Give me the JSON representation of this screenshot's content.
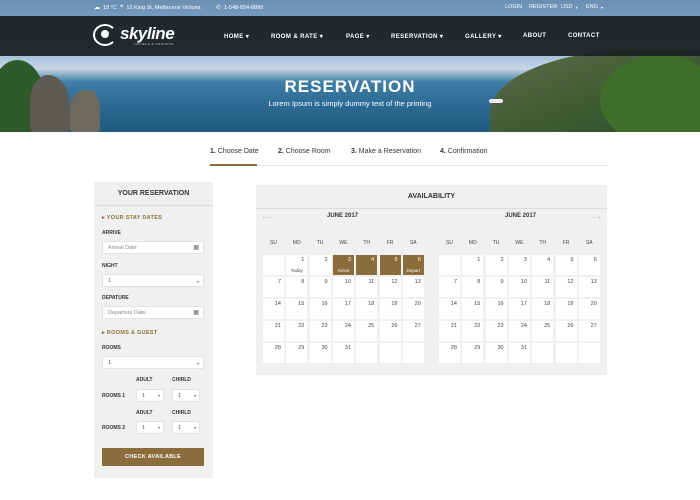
{
  "topbar": {
    "weather": "18 °C",
    "address": "12 King St, Melbourne Victoria",
    "phone": "1-548-854-8898",
    "login": "LOGIN",
    "register": "REGISTER",
    "currency": "USD",
    "language": "ENG"
  },
  "logo": {
    "name": "skyline",
    "tagline": "HOTELS & RESORTS"
  },
  "menu": [
    {
      "label": "HOME",
      "caret": "▾"
    },
    {
      "label": "ROOM & RATE",
      "caret": "▾"
    },
    {
      "label": "PAGE",
      "caret": "▾"
    },
    {
      "label": "RESERVATION",
      "caret": "▾"
    },
    {
      "label": "GALLERY",
      "caret": "▾"
    },
    {
      "label": "ABOUT",
      "caret": ""
    },
    {
      "label": "CONTACT",
      "caret": ""
    }
  ],
  "hero": {
    "title": "RESERVATION",
    "subtitle": "Lorem Ipsum is simply dummy text of the printing"
  },
  "steps": [
    {
      "num": "1.",
      "label": "Choose Date"
    },
    {
      "num": "2.",
      "label": "Choose Room"
    },
    {
      "num": "3.",
      "label": "Make a Reservation"
    },
    {
      "num": "4.",
      "label": "Confirmation"
    }
  ],
  "panel": {
    "title": "YOUR RESERVATION",
    "stay_section": "YOUR STAY DATES",
    "arrive_label": "ARRIVE",
    "arrive_placeholder": "Arrival Date",
    "night_label": "NIGHT",
    "night_value": "1",
    "depature_label": "DEPATURE",
    "depature_placeholder": "Departure Date",
    "rooms_section": "ROOMS & GUEST",
    "rooms_label": "ROOMS",
    "rooms_value": "1",
    "adult_label": "ADULT",
    "chirld_label": "CHIRLD",
    "room1_label": "ROOMS 1",
    "room2_label": "ROOMS 2",
    "room1_adult": "1",
    "room1_child": "1",
    "room2_adult": "1",
    "room2_child": "1",
    "button": "CHECK AVAILABLE"
  },
  "calendar": {
    "title": "AVAILABILITY",
    "weekdays": [
      "SU",
      "MO",
      "TU",
      "WE",
      "TH",
      "FR",
      "SA"
    ],
    "months": [
      {
        "name": "JUNE 2017",
        "weeks": [
          [
            "",
            "1",
            "2",
            "3",
            "4",
            "5",
            "6"
          ],
          [
            "7",
            "8",
            "9",
            "10",
            "11",
            "12",
            "13"
          ],
          [
            "14",
            "15",
            "16",
            "17",
            "18",
            "19",
            "20"
          ],
          [
            "21",
            "22",
            "23",
            "24",
            "25",
            "26",
            "27"
          ],
          [
            "28",
            "29",
            "30",
            "31",
            "",
            "",
            ""
          ]
        ],
        "selected": [
          "3",
          "4",
          "5",
          "6"
        ],
        "notes": {
          "1": "Today",
          "3": "Arrive",
          "6": "Depart"
        }
      },
      {
        "name": "JUNE 2017",
        "weeks": [
          [
            "",
            "1",
            "2",
            "3",
            "4",
            "5",
            "6"
          ],
          [
            "7",
            "8",
            "9",
            "10",
            "11",
            "12",
            "13"
          ],
          [
            "14",
            "15",
            "16",
            "17",
            "18",
            "19",
            "20"
          ],
          [
            "21",
            "22",
            "23",
            "24",
            "25",
            "26",
            "27"
          ],
          [
            "28",
            "29",
            "30",
            "31",
            "",
            "",
            ""
          ]
        ],
        "selected": [],
        "notes": {}
      }
    ]
  },
  "colors": {
    "accent": "#8a6d3b",
    "nav_bg": "#1c1e20",
    "panel_bg": "#f0f0f0"
  },
  "icons": {
    "weather": "cloud-icon",
    "address": "map-marker-icon",
    "phone": "phone-icon",
    "calendar": "calendar-icon",
    "dropdown": "chevron-down-icon",
    "section": "caret-right-icon",
    "prev": "arrow-left-icon",
    "next": "arrow-right-icon"
  }
}
